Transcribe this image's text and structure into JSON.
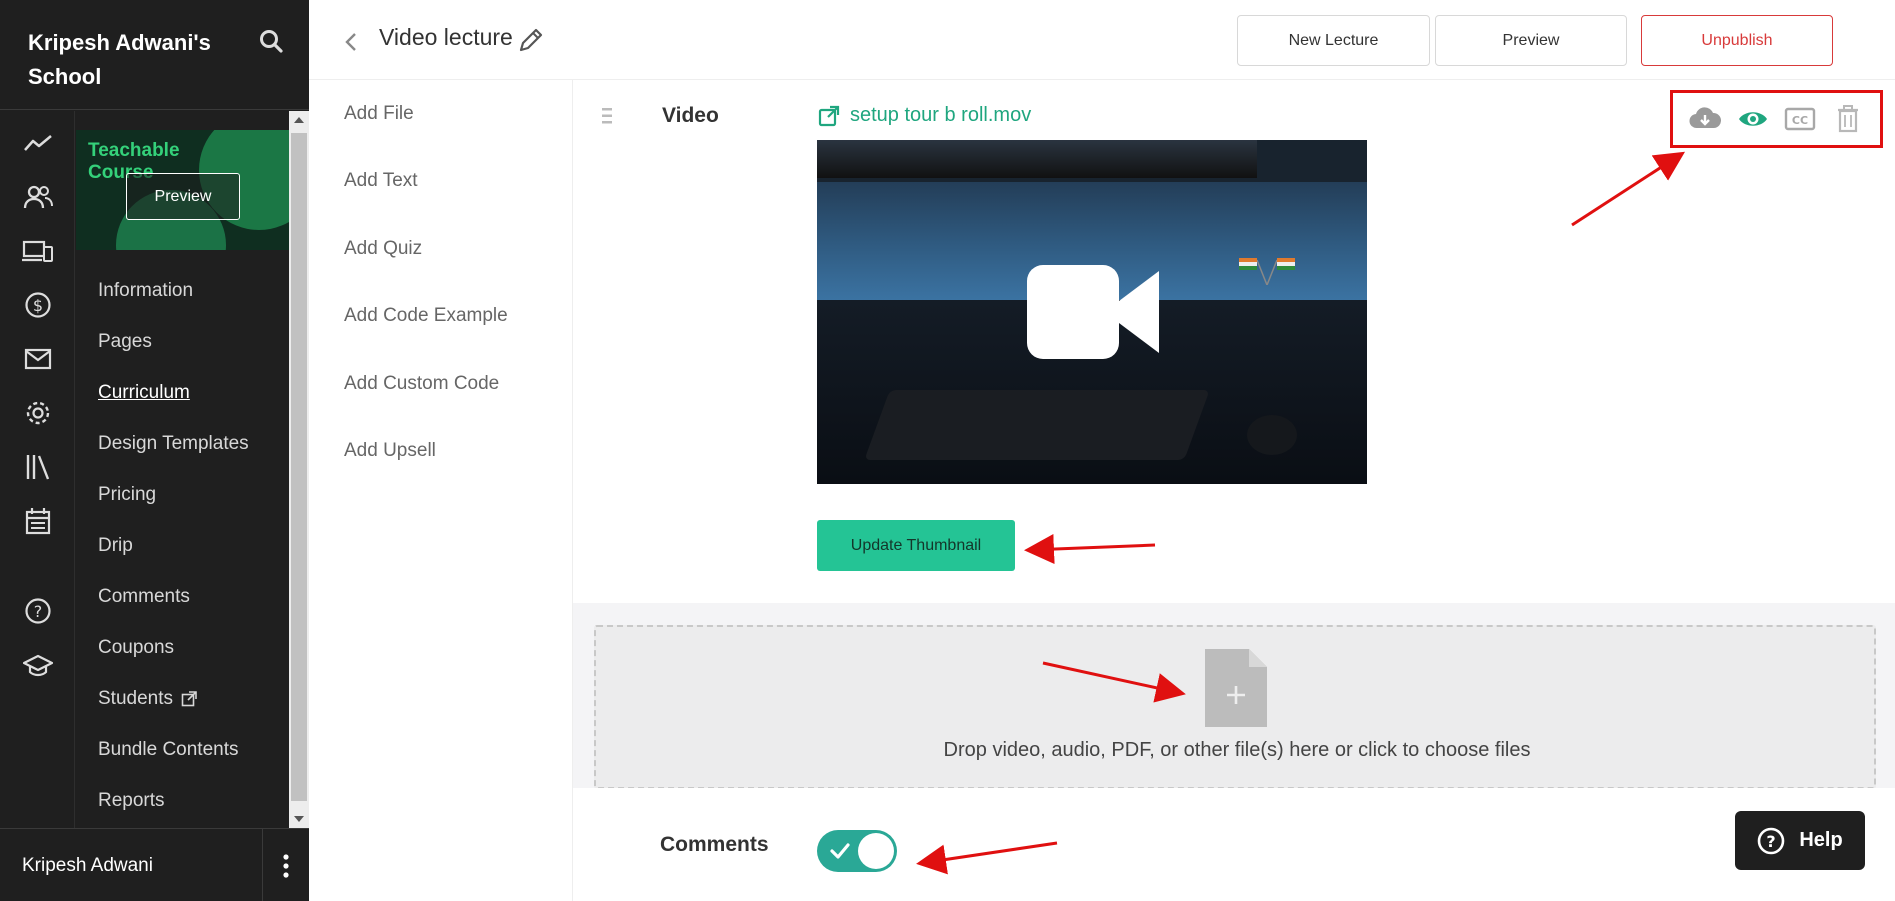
{
  "school": {
    "name": "Kripesh Adwani's School"
  },
  "course_thumb": {
    "title": "Teachable Course",
    "preview_label": "Preview"
  },
  "sidebar": {
    "items": [
      {
        "label": "Information"
      },
      {
        "label": "Pages"
      },
      {
        "label": "Curriculum",
        "active": true
      },
      {
        "label": "Design Templates"
      },
      {
        "label": "Pricing"
      },
      {
        "label": "Drip"
      },
      {
        "label": "Comments"
      },
      {
        "label": "Coupons"
      },
      {
        "label": "Students"
      },
      {
        "label": "Bundle Contents"
      },
      {
        "label": "Reports"
      }
    ],
    "rail_icons": [
      "analytics-icon",
      "users-icon",
      "devices-icon",
      "dollar-icon",
      "mail-icon",
      "settings-icon",
      "library-icon",
      "calendar-icon",
      "help-circle-icon",
      "graduation-cap-icon"
    ]
  },
  "user": {
    "name": "Kripesh Adwani"
  },
  "header": {
    "title": "Video lecture",
    "buttons": {
      "new_lecture": "New Lecture",
      "preview": "Preview",
      "unpublish": "Unpublish"
    }
  },
  "add_panel": {
    "items": [
      "Add File",
      "Add Text",
      "Add Quiz",
      "Add Code Example",
      "Add Custom Code",
      "Add Upsell"
    ]
  },
  "video": {
    "label": "Video",
    "file_name": "setup tour b roll.mov",
    "actions": [
      "download-icon",
      "eye-icon",
      "closed-captions-icon",
      "trash-icon"
    ],
    "update_thumbnail_label": "Update Thumbnail"
  },
  "drop_area": {
    "text": "Drop video, audio, PDF, or other file(s) here or click to choose files"
  },
  "comments": {
    "label": "Comments",
    "enabled": true
  },
  "help": {
    "label": "Help"
  },
  "colors": {
    "accent": "#24c495",
    "danger": "#d83a3a",
    "sidebar_bg": "#1f1f1f",
    "annotation": "#e01010"
  }
}
